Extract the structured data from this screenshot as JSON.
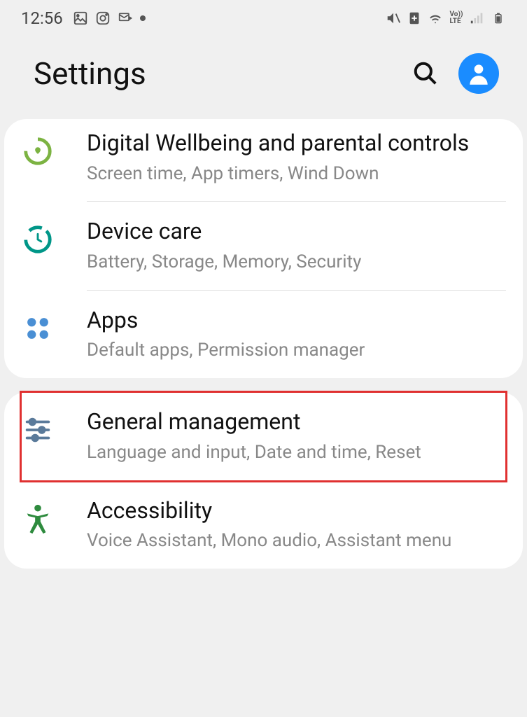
{
  "status": {
    "time": "12:56"
  },
  "header": {
    "title": "Settings"
  },
  "group1": {
    "items": [
      {
        "title": "Digital Wellbeing and parental controls",
        "subtitle": "Screen time, App timers, Wind Down"
      },
      {
        "title": "Device care",
        "subtitle": "Battery, Storage, Memory, Security"
      },
      {
        "title": "Apps",
        "subtitle": "Default apps, Permission manager"
      }
    ]
  },
  "group2": {
    "items": [
      {
        "title": "General management",
        "subtitle": "Language and input, Date and time, Reset"
      },
      {
        "title": "Accessibility",
        "subtitle": "Voice Assistant, Mono audio, Assistant menu"
      }
    ]
  }
}
